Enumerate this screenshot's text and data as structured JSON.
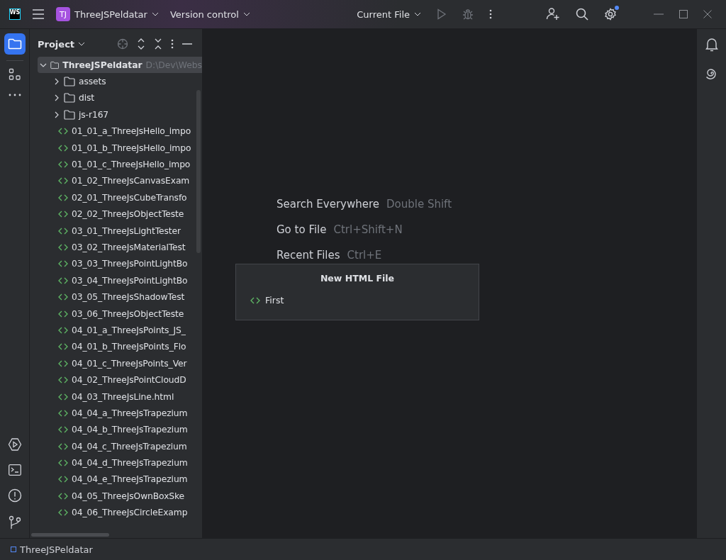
{
  "title_bar": {
    "logo_text": "WS",
    "project_badge": "TJ",
    "project_name": "ThreeJSPeldatar",
    "vcs_menu": "Version control",
    "run_config": "Current File",
    "settings_has_update": true
  },
  "project_panel": {
    "title": "Project",
    "tree": [
      {
        "kind": "folder",
        "label": "ThreeJSPeldatar",
        "path": "D:\\Dev\\Webs",
        "selected": true,
        "expanded": true,
        "children": [
          {
            "kind": "folder",
            "label": "assets",
            "selected": false,
            "expanded": false
          },
          {
            "kind": "folder",
            "label": "dist",
            "selected": false,
            "expanded": false
          },
          {
            "kind": "folder",
            "label": "js-r167",
            "selected": false,
            "expanded": false
          },
          {
            "kind": "file",
            "label": "01_01_a_ThreeJsHello_impo",
            "selected": false
          },
          {
            "kind": "file",
            "label": "01_01_b_ThreeJsHello_impo",
            "selected": false
          },
          {
            "kind": "file",
            "label": "01_01_c_ThreeJsHello_impo",
            "selected": false
          },
          {
            "kind": "file",
            "label": "01_02_ThreeJsCanvasExam",
            "selected": false
          },
          {
            "kind": "file",
            "label": "02_01_ThreeJsCubeTransfo",
            "selected": false
          },
          {
            "kind": "file",
            "label": "02_02_ThreeJsObjectTeste",
            "selected": false
          },
          {
            "kind": "file",
            "label": "03_01_ThreeJsLightTester",
            "selected": false
          },
          {
            "kind": "file",
            "label": "03_02_ThreeJsMaterialTest",
            "selected": false
          },
          {
            "kind": "file",
            "label": "03_03_ThreeJsPointLightBo",
            "selected": false
          },
          {
            "kind": "file",
            "label": "03_04_ThreeJsPointLightBo",
            "selected": false
          },
          {
            "kind": "file",
            "label": "03_05_ThreeJsShadowTest",
            "selected": false
          },
          {
            "kind": "file",
            "label": "03_06_ThreeJsObjectTeste",
            "selected": false
          },
          {
            "kind": "file",
            "label": "04_01_a_ThreeJsPoints_JS_",
            "selected": false
          },
          {
            "kind": "file",
            "label": "04_01_b_ThreeJsPoints_Flo",
            "selected": false
          },
          {
            "kind": "file",
            "label": "04_01_c_ThreeJsPoints_Ver",
            "selected": false
          },
          {
            "kind": "file",
            "label": "04_02_ThreeJsPointCloudD",
            "selected": false
          },
          {
            "kind": "file",
            "label": "04_03_ThreeJsLine.html",
            "selected": false
          },
          {
            "kind": "file",
            "label": "04_04_a_ThreeJsTrapezium",
            "selected": false
          },
          {
            "kind": "file",
            "label": "04_04_b_ThreeJsTrapezium",
            "selected": false
          },
          {
            "kind": "file",
            "label": "04_04_c_ThreeJsTrapezium",
            "selected": false
          },
          {
            "kind": "file",
            "label": "04_04_d_ThreeJsTrapezium",
            "selected": false
          },
          {
            "kind": "file",
            "label": "04_04_e_ThreeJsTrapezium",
            "selected": false
          },
          {
            "kind": "file",
            "label": "04_05_ThreeJsOwnBoxSke",
            "selected": false
          },
          {
            "kind": "file",
            "label": "04_06_ThreeJsCircleExamp",
            "selected": false
          }
        ]
      }
    ]
  },
  "editor_hints": [
    {
      "action": "Search Everywhere",
      "shortcut": "Double Shift"
    },
    {
      "action": "Go to File",
      "shortcut": "Ctrl+Shift+N"
    },
    {
      "action": "Recent Files",
      "shortcut": "Ctrl+E"
    }
  ],
  "popup": {
    "title": "New HTML File",
    "items": [
      {
        "label": "First"
      }
    ]
  },
  "status_bar": {
    "breadcrumb": "ThreeJSPeldatar"
  }
}
